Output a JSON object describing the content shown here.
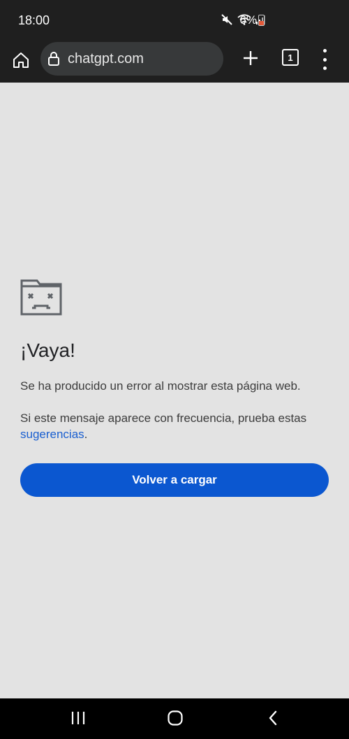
{
  "status_bar": {
    "time": "18:00",
    "battery": "6%",
    "icons": [
      "mute-icon",
      "wifi-icon",
      "signal-icon",
      "battery-icon"
    ]
  },
  "toolbar": {
    "url": "chatgpt.com",
    "tab_count": "1",
    "icons": [
      "home-icon",
      "lock-icon",
      "plus-icon",
      "tabs-icon",
      "more-vert-icon"
    ]
  },
  "error_page": {
    "headline": "¡Vaya!",
    "message": "Se ha producido un error al mostrar esta página web.",
    "hint_prefix": "Si este mensaje aparece con frecuencia, prueba estas ",
    "hint_link": "sugerencias",
    "hint_suffix": ".",
    "reload_label": "Volver a cargar",
    "icon": "sad-page-icon"
  },
  "nav_bar": {
    "icons": [
      "recents-icon",
      "home-icon",
      "back-icon"
    ]
  },
  "colors": {
    "chrome_dark": "#1f1f1f",
    "omnibox": "#37393a",
    "page_background": "#e3e3e3",
    "button_blue": "#0b57d0",
    "link_blue": "#1a5fd0"
  }
}
